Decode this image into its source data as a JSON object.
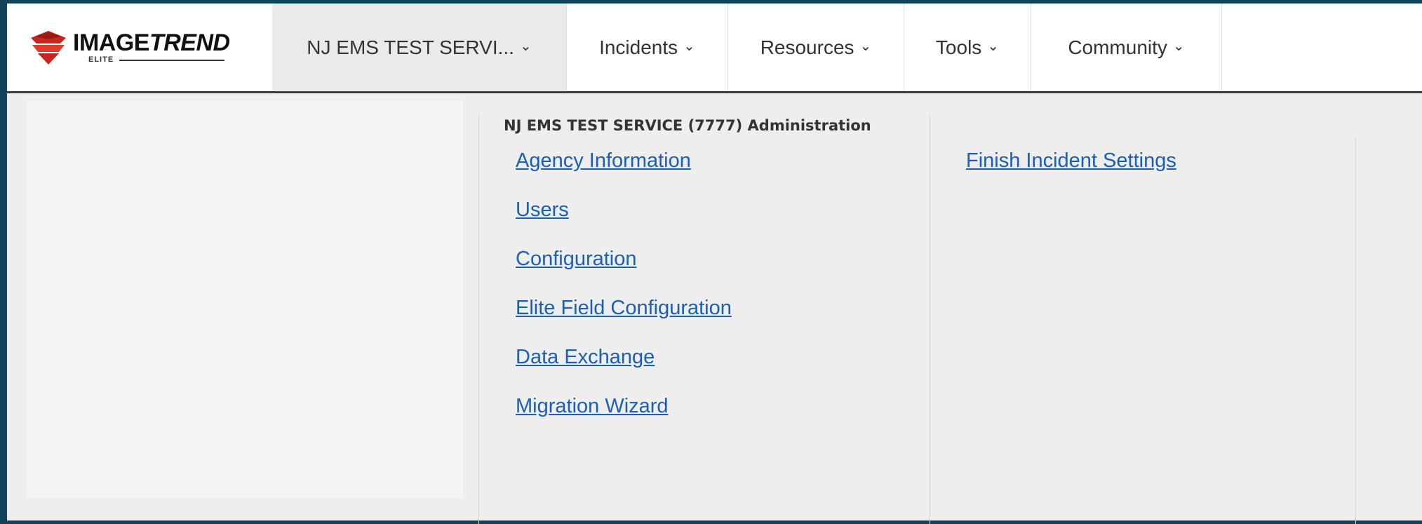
{
  "logo": {
    "brand_prefix": "IMAGE",
    "brand_suffix": "TREND",
    "sub": "ELITE",
    "icon": "imagetrend-logo-icon"
  },
  "nav": {
    "items": [
      {
        "label": "NJ EMS TEST SERVI...",
        "icon": "chevron-down-icon"
      },
      {
        "label": "Incidents",
        "icon": "chevron-down-icon"
      },
      {
        "label": "Resources",
        "icon": "chevron-down-icon"
      },
      {
        "label": "Tools",
        "icon": "chevron-down-icon"
      },
      {
        "label": "Community",
        "icon": "chevron-down-icon"
      }
    ]
  },
  "dropdown": {
    "heading": "NJ EMS TEST SERVICE (7777) Administration",
    "col1": [
      "Agency Information",
      "Users",
      "Configuration",
      "Elite Field Configuration",
      "Data Exchange",
      "Migration Wizard"
    ],
    "col2": [
      "Finish Incident Settings"
    ]
  },
  "colors": {
    "background": "#13435a",
    "link": "#1a5fb4",
    "panel": "#eeeeee",
    "logo_red": "#c8261d"
  }
}
